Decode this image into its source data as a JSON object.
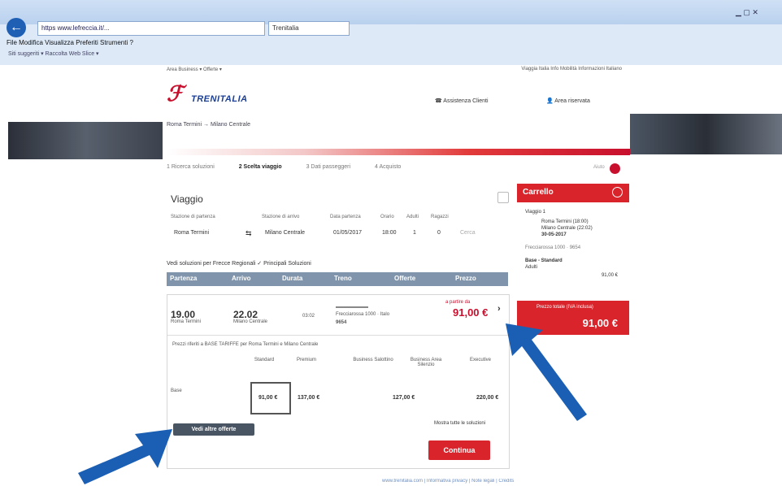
{
  "browser": {
    "address": "https www.lefreccia.it/...",
    "tab_title": "Trenitalia",
    "menu": "File  Modifica  Visualizza  Preferiti  Strumenti  ?",
    "favorites": "Siti suggeriti ▾  Raccolta Web Slice ▾"
  },
  "site": {
    "top_left": "Area Business ▾   Offerte ▾",
    "top_right": "Viaggia Italia   Info Mobilità   Informazioni   Italiano",
    "logo": "TRENITALIA",
    "contact": "Assistenza Clienti",
    "account": "Area riservata",
    "breadcrumb": "Roma Termini → Milano Centrale",
    "steps": [
      "1 Ricerca soluzioni",
      "2 Scelta viaggio",
      "3 Dati passeggeri",
      "4 Acquisto"
    ],
    "step_right": "Aiuto"
  },
  "search": {
    "title": "Viaggio",
    "labels": {
      "from": "Stazione di partenza",
      "to": "Stazione di arrivo",
      "date": "Data partenza",
      "time": "Orario",
      "adults": "Adulti",
      "kids": "Ragazzi"
    },
    "values": {
      "from": "Roma Termini",
      "to": "Milano Centrale",
      "date": "01/05/2017",
      "time": "18:00",
      "adults": "1",
      "kids": "0",
      "btn": "Cerca"
    },
    "filters": "Vedi soluzioni per   Frecce   Regionali   ✓ Principali Soluzioni"
  },
  "table": {
    "headers": [
      "Partenza",
      "Arrivo",
      "Durata",
      "Treno",
      "Offerte",
      "Prezzo"
    ]
  },
  "result": {
    "dep_time": "19.00",
    "dep_station": "Roma Termini",
    "arr_time": "22.02",
    "arr_station": "Milano Centrale",
    "duration": "03:02",
    "train": "Frecciarossa 1000 · Italo",
    "train_no": "9654",
    "price_label": "a partire da",
    "price": "91,00 €",
    "offer_desc": "Prezzi riferiti a BASE TARIFFE per Roma Termini e Milano Centrale",
    "col_headers": [
      "Standard",
      "Premium",
      "Business Salottino",
      "Business Area Silenzio",
      "Executive"
    ],
    "row_label": "Base",
    "cells": [
      "91,00 €",
      "137,00 €",
      "127,00 €",
      "220,00 €"
    ],
    "more_btn": "Vedi altre offerte",
    "check_label": "Mostra tutte le soluzioni",
    "continue_btn": "Continua"
  },
  "cart": {
    "title": "Carrello",
    "lines": [
      "Viaggio 1",
      "Roma Termini (18:00)",
      "Milano Centrale (22:02)",
      "30-05-2017",
      "Frecciarossa 1000 · 9654",
      "Base - Standard"
    ],
    "adult_label": "Adulti",
    "subtotal": "91,00 €",
    "total_label": "Prezzo totale (IVA inclusa)",
    "total": "91,00 €"
  },
  "footer": "www.trenitalia.com | Informativa privacy | Note legali | Credits",
  "colors": {
    "brand_red": "#c8102e",
    "brand_blue": "#1c3f94",
    "arrow_blue": "#1a5fb4"
  }
}
